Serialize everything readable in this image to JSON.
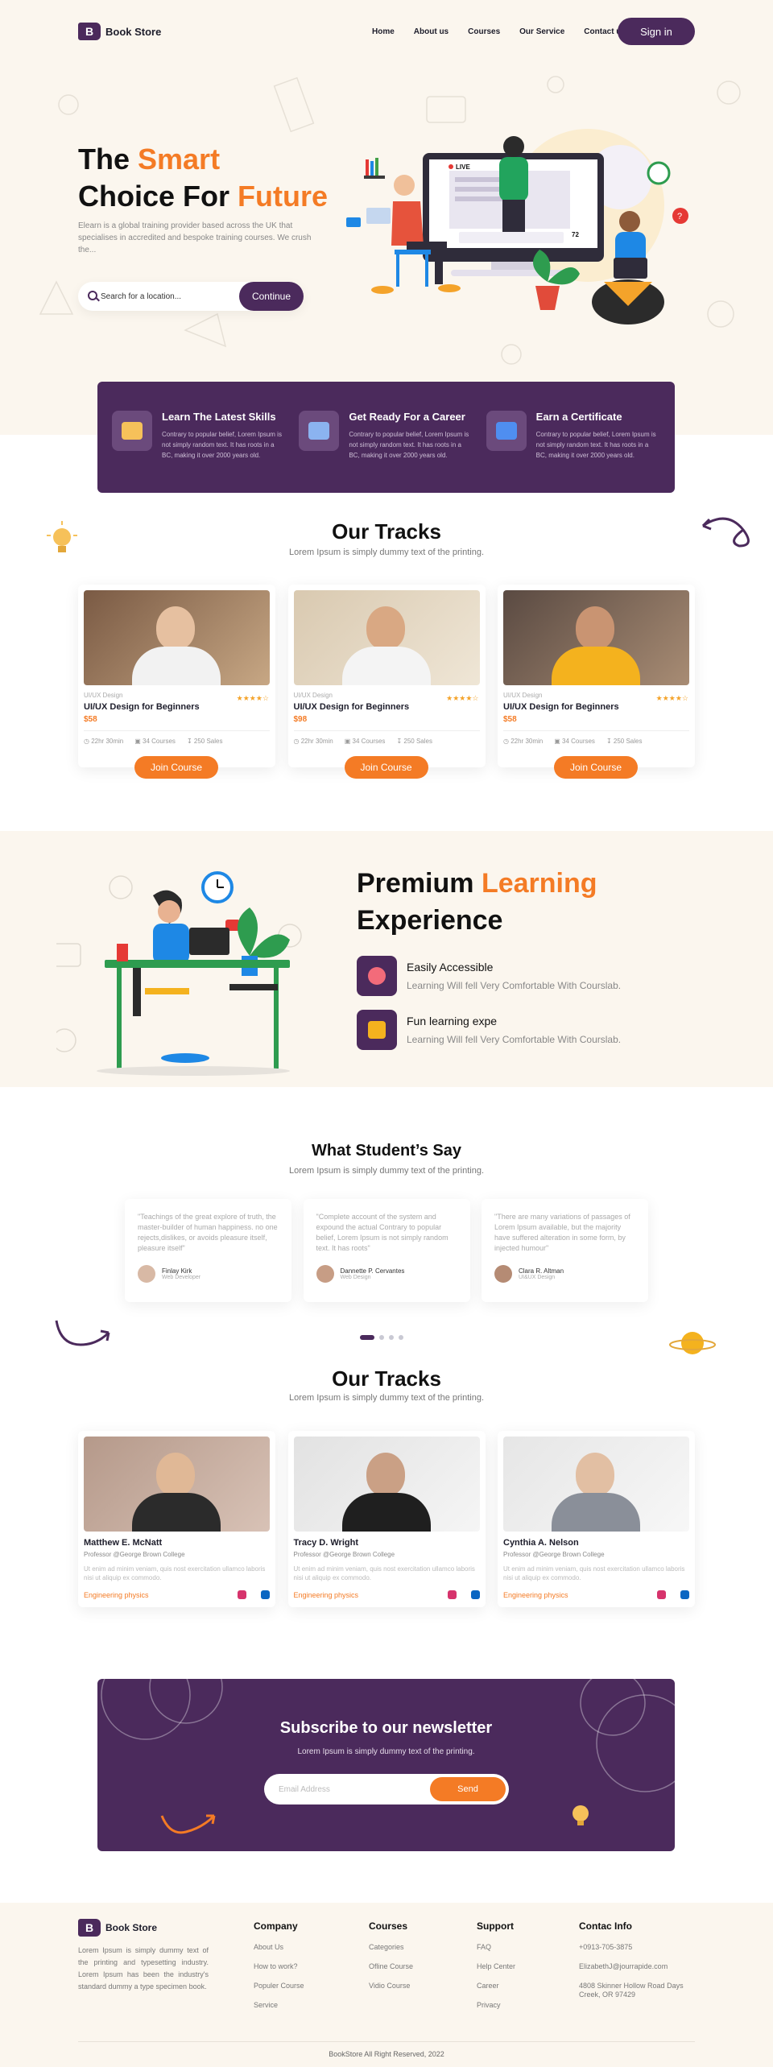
{
  "nav": {
    "brand": "Book Store",
    "links": [
      "Home",
      "About us",
      "Courses",
      "Our Service",
      "Contact us"
    ],
    "signin": "Sign in"
  },
  "hero": {
    "title_1": "The ",
    "title_accent_1": "Smart",
    "title_2": "Choice For ",
    "title_accent_2": "Future",
    "description": "Elearn is a global training provider based across the UK that specialises in accredited and bespoke training courses. We crush the...",
    "search_placeholder": "Search for a location...",
    "continue": "Continue",
    "screen_badge": "LIVE",
    "screen_count": "72"
  },
  "features": [
    {
      "title": "Learn The Latest Skills",
      "text": "Contrary to popular belief, Lorem Ipsum is not simply random text. It has roots in a BC, making it over 2000 years old."
    },
    {
      "title": "Get Ready For a Career",
      "text": "Contrary to popular belief, Lorem Ipsum is not simply random text. It has roots in a BC, making it over 2000 years old."
    },
    {
      "title": "Earn a Certificate",
      "text": "Contrary to popular belief, Lorem Ipsum is not simply random text. It has roots in a BC, making it over 2000 years old."
    }
  ],
  "tracks": {
    "title": "Our Tracks",
    "subtitle": "Lorem Ipsum is simply dummy text of the printing.",
    "cards": [
      {
        "category": "UI/UX Design",
        "stars": "★★★★☆",
        "title": "UI/UX Design for Beginners",
        "price": "$58",
        "duration": "22hr 30min",
        "courses": "34 Courses",
        "sales": "250 Sales",
        "button": "Join Course"
      },
      {
        "category": "UI/UX Design",
        "stars": "★★★★☆",
        "title": "UI/UX Design for Beginners",
        "price": "$98",
        "duration": "22hr 30min",
        "courses": "34 Courses",
        "sales": "250 Sales",
        "button": "Join Course"
      },
      {
        "category": "UI/UX Design",
        "stars": "★★★★☆",
        "title": "UI/UX Design for Beginners",
        "price": "$58",
        "duration": "22hr 30min",
        "courses": "34 Courses",
        "sales": "250 Sales",
        "button": "Join Course"
      }
    ]
  },
  "premium": {
    "title_1": "Premium ",
    "title_accent": "Learning",
    "title_2": "Experience",
    "items": [
      {
        "title": "Easily Accessible",
        "text": "Learning Will fell Very Comfortable With Courslab."
      },
      {
        "title": "Fun learning expe",
        "text": "Learning Will fell Very Comfortable With Courslab."
      }
    ]
  },
  "testimonials": {
    "title": "What Student’s Say",
    "subtitle": "Lorem Ipsum is simply dummy text of the printing.",
    "items": [
      {
        "quote": "\"Teachings of the great explore of truth, the master-builder of human happiness. no one rejects,dislikes, or avoids pleasure itself, pleasure itself\"",
        "name": "Finlay Kirk",
        "role": "Web Developer"
      },
      {
        "quote": "\"Complete account of the system and expound the actual Contrary to popular belief, Lorem Ipsum is not simply random text. It has roots\"",
        "name": "Dannette P. Cervantes",
        "role": "Web Design"
      },
      {
        "quote": "\"There are many variations of passages of Lorem Ipsum available, but the majority have suffered alteration in some form, by injected humour\"",
        "name": "Clara R. Altman",
        "role": "UI&UX Design"
      }
    ]
  },
  "instructors": {
    "title": "Our Tracks",
    "subtitle": "Lorem Ipsum is simply dummy text of the printing.",
    "items": [
      {
        "name": "Matthew E. McNatt",
        "role": "Professor @George Brown College",
        "text": "Ut enim ad minim veniam, quis nost exercitation ullamco laboris nisi ut aliquip ex commodo.",
        "subject": "Engineering physics"
      },
      {
        "name": "Tracy D. Wright",
        "role": "Professor @George Brown College",
        "text": "Ut enim ad minim veniam, quis nost exercitation ullamco laboris nisi ut aliquip ex commodo.",
        "subject": "Engineering physics"
      },
      {
        "name": "Cynthia A. Nelson",
        "role": "Professor @George Brown College",
        "text": "Ut enim ad minim veniam, quis nost exercitation ullamco laboris nisi ut aliquip ex commodo.",
        "subject": "Engineering physics"
      }
    ]
  },
  "newsletter": {
    "title": "Subscribe to our newsletter",
    "subtitle": "Lorem Ipsum is simply dummy text of the printing.",
    "placeholder": "Email Address",
    "button": "Send"
  },
  "footer": {
    "brand": "Book Store",
    "description": "Lorem Ipsum is simply dummy text of the printing and typesetting industry. Lorem Ipsum has been the industry's standard dummy a type specimen book.",
    "company": {
      "title": "Company",
      "links": [
        "About Us",
        "How to work?",
        "Populer Course",
        "Service"
      ]
    },
    "courses": {
      "title": "Courses",
      "links": [
        "Categories",
        "Ofline Course",
        "Vidio Course"
      ]
    },
    "support": {
      "title": "Support",
      "links": [
        "FAQ",
        "Help Center",
        "Career",
        "Privacy"
      ]
    },
    "contact": {
      "title": "Contac Info",
      "phone": "+0913-705-3875",
      "email": "ElizabethJ@jourrapide.com",
      "address": "4808 Skinner Hollow Road Days Creek, OR 97429"
    },
    "copyright": "BookStore All Right Reserved, 2022"
  },
  "colors": {
    "primary": "#4b2a5c",
    "accent": "#f47b25",
    "cream": "#fbf6ee"
  }
}
